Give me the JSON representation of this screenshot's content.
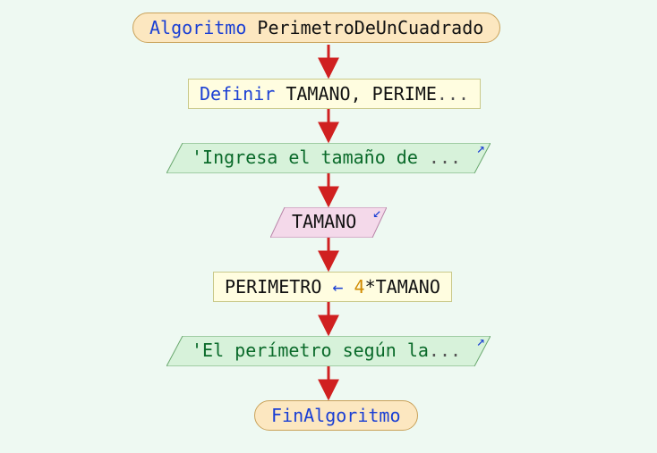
{
  "nodes": {
    "start": {
      "kw": "Algoritmo",
      "name": "PerimetroDeUnCuadrado"
    },
    "define": {
      "kw": "Definir",
      "vars": "TAMANO, PERIME",
      "ell": "..."
    },
    "prompt1": {
      "text": "'Ingresa el tamaño de ",
      "ell": "..."
    },
    "input": {
      "var": "TAMANO"
    },
    "assign": {
      "lhs": "PERIMETRO",
      "arrow": "←",
      "coef": "4",
      "op": "*",
      "rhs": "TAMANO"
    },
    "prompt2": {
      "text": "'El perímetro según la",
      "ell": "..."
    },
    "end": {
      "kw": "FinAlgoritmo"
    }
  },
  "colors": {
    "flow_arrow": "#d02020",
    "io_out_fill": "#d7f2da",
    "io_out_stroke": "#6aa86f",
    "io_in_fill": "#f4d9ea",
    "io_in_stroke": "#b884a8"
  },
  "chart_data": {
    "type": "flowchart",
    "title": "PerimetroDeUnCuadrado",
    "steps": [
      {
        "id": "start",
        "kind": "terminal",
        "label": "Algoritmo PerimetroDeUnCuadrado"
      },
      {
        "id": "define",
        "kind": "process",
        "label": "Definir TAMANO, PERIME..."
      },
      {
        "id": "prompt1",
        "kind": "output",
        "label": "'Ingresa el tamaño de ..."
      },
      {
        "id": "input",
        "kind": "input",
        "label": "TAMANO"
      },
      {
        "id": "assign",
        "kind": "process",
        "label": "PERIMETRO ← 4*TAMANO"
      },
      {
        "id": "prompt2",
        "kind": "output",
        "label": "'El perímetro según la..."
      },
      {
        "id": "end",
        "kind": "terminal",
        "label": "FinAlgoritmo"
      }
    ],
    "edges": [
      [
        "start",
        "define"
      ],
      [
        "define",
        "prompt1"
      ],
      [
        "prompt1",
        "input"
      ],
      [
        "input",
        "assign"
      ],
      [
        "assign",
        "prompt2"
      ],
      [
        "prompt2",
        "end"
      ]
    ]
  }
}
